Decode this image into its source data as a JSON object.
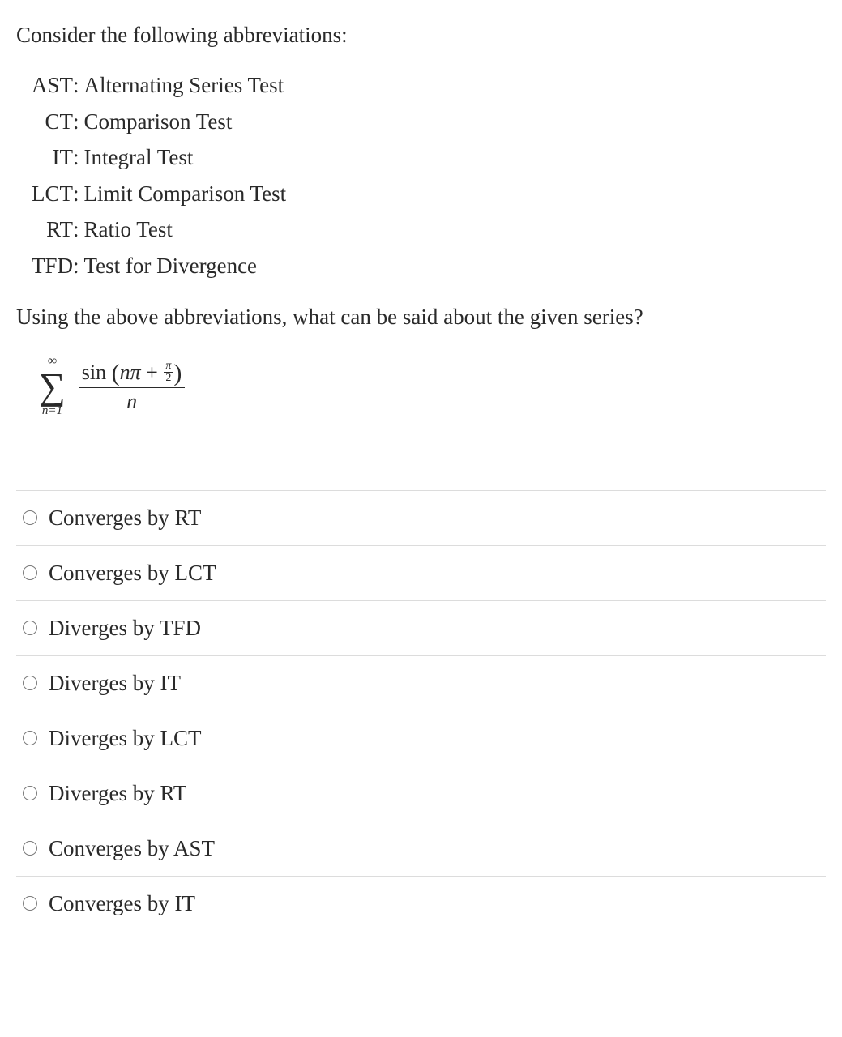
{
  "intro": "Consider the following abbreviations:",
  "abbreviations": [
    {
      "code": "AST",
      "desc": "Alternating Series Test"
    },
    {
      "code": "CT",
      "desc": "Comparison Test"
    },
    {
      "code": "IT",
      "desc": "Integral Test"
    },
    {
      "code": "LCT",
      "desc": "Limit Comparison Test"
    },
    {
      "code": "RT",
      "desc": "Ratio Test"
    },
    {
      "code": "TFD",
      "desc": "Test for Divergence"
    }
  ],
  "prompt": "Using the above abbreviations, what can be said about the given series?",
  "formula": {
    "sum_upper": "∞",
    "sum_lower": "n=1",
    "numerator_plain": "sin(nπ + π/2)",
    "denominator": "n"
  },
  "options": [
    "Converges by RT",
    "Converges by LCT",
    "Diverges by TFD",
    "Diverges by IT",
    "Diverges by LCT",
    "Diverges by RT",
    "Converges by AST",
    "Converges by IT"
  ]
}
